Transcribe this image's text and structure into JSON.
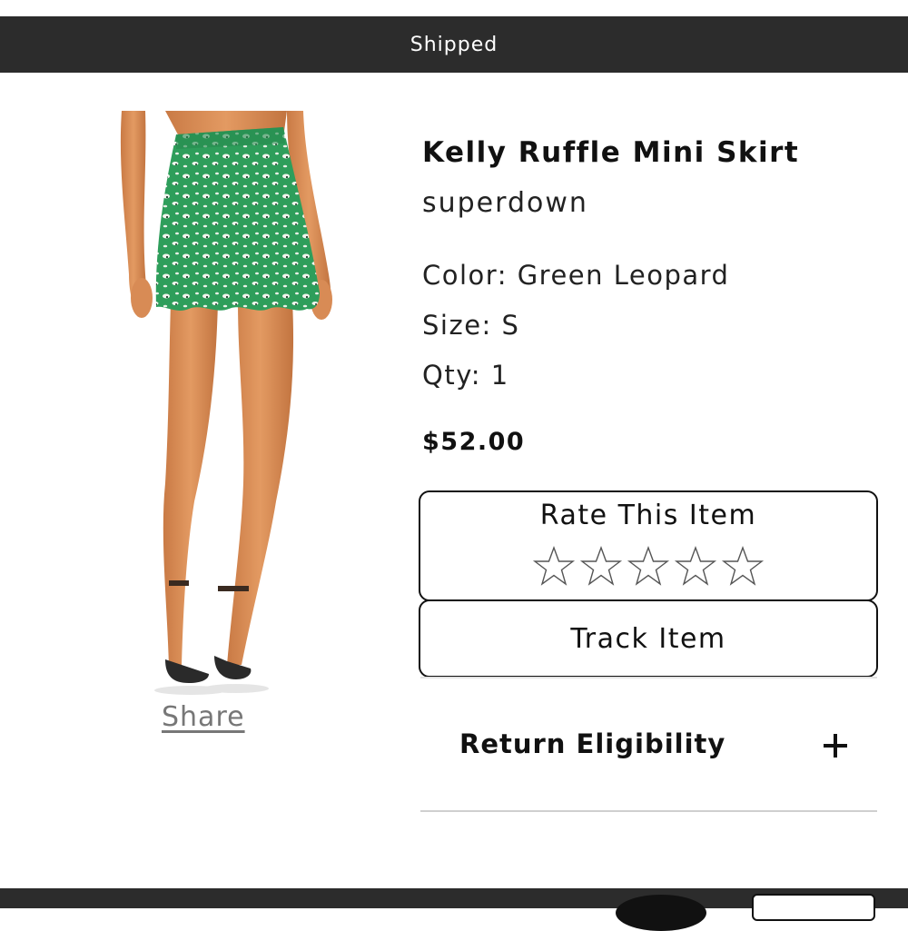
{
  "status": {
    "label": "Shipped"
  },
  "product": {
    "name": "Kelly Ruffle Mini Skirt",
    "brand": "superdown",
    "color": "Color: Green Leopard",
    "size": "Size: S",
    "qty": "Qty: 1",
    "price": "$52.00",
    "image_description_icon": "product-photo"
  },
  "share": {
    "label": "Share"
  },
  "rating": {
    "title": "Rate This Item",
    "stars_total": 5,
    "stars_filled": 0
  },
  "track": {
    "label": "Track Item"
  },
  "returns": {
    "label": "Return Eligibility",
    "icon": "plus-icon"
  },
  "colors": {
    "status_bar": "#2c2c2c",
    "skirt_green": "#2e9e5b",
    "text": "#111111",
    "link_gray": "#777777"
  }
}
